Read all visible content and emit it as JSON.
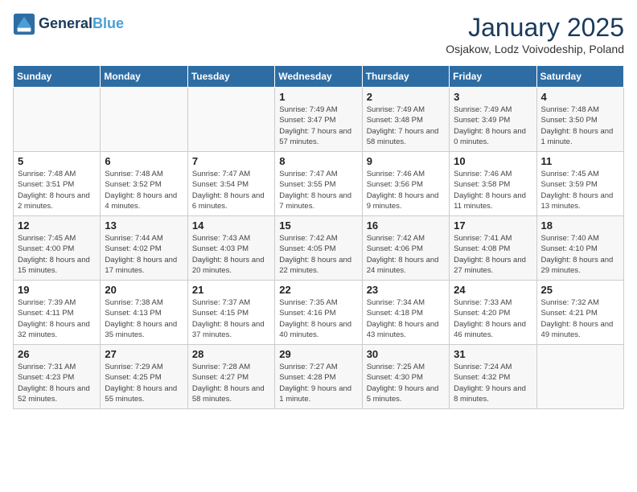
{
  "header": {
    "logo_line1": "General",
    "logo_line2": "Blue",
    "title": "January 2025",
    "subtitle": "Osjakow, Lodz Voivodeship, Poland"
  },
  "days_of_week": [
    "Sunday",
    "Monday",
    "Tuesday",
    "Wednesday",
    "Thursday",
    "Friday",
    "Saturday"
  ],
  "weeks": [
    [
      {
        "day": "",
        "info": ""
      },
      {
        "day": "",
        "info": ""
      },
      {
        "day": "",
        "info": ""
      },
      {
        "day": "1",
        "info": "Sunrise: 7:49 AM\nSunset: 3:47 PM\nDaylight: 7 hours and 57 minutes."
      },
      {
        "day": "2",
        "info": "Sunrise: 7:49 AM\nSunset: 3:48 PM\nDaylight: 7 hours and 58 minutes."
      },
      {
        "day": "3",
        "info": "Sunrise: 7:49 AM\nSunset: 3:49 PM\nDaylight: 8 hours and 0 minutes."
      },
      {
        "day": "4",
        "info": "Sunrise: 7:48 AM\nSunset: 3:50 PM\nDaylight: 8 hours and 1 minute."
      }
    ],
    [
      {
        "day": "5",
        "info": "Sunrise: 7:48 AM\nSunset: 3:51 PM\nDaylight: 8 hours and 2 minutes."
      },
      {
        "day": "6",
        "info": "Sunrise: 7:48 AM\nSunset: 3:52 PM\nDaylight: 8 hours and 4 minutes."
      },
      {
        "day": "7",
        "info": "Sunrise: 7:47 AM\nSunset: 3:54 PM\nDaylight: 8 hours and 6 minutes."
      },
      {
        "day": "8",
        "info": "Sunrise: 7:47 AM\nSunset: 3:55 PM\nDaylight: 8 hours and 7 minutes."
      },
      {
        "day": "9",
        "info": "Sunrise: 7:46 AM\nSunset: 3:56 PM\nDaylight: 8 hours and 9 minutes."
      },
      {
        "day": "10",
        "info": "Sunrise: 7:46 AM\nSunset: 3:58 PM\nDaylight: 8 hours and 11 minutes."
      },
      {
        "day": "11",
        "info": "Sunrise: 7:45 AM\nSunset: 3:59 PM\nDaylight: 8 hours and 13 minutes."
      }
    ],
    [
      {
        "day": "12",
        "info": "Sunrise: 7:45 AM\nSunset: 4:00 PM\nDaylight: 8 hours and 15 minutes."
      },
      {
        "day": "13",
        "info": "Sunrise: 7:44 AM\nSunset: 4:02 PM\nDaylight: 8 hours and 17 minutes."
      },
      {
        "day": "14",
        "info": "Sunrise: 7:43 AM\nSunset: 4:03 PM\nDaylight: 8 hours and 20 minutes."
      },
      {
        "day": "15",
        "info": "Sunrise: 7:42 AM\nSunset: 4:05 PM\nDaylight: 8 hours and 22 minutes."
      },
      {
        "day": "16",
        "info": "Sunrise: 7:42 AM\nSunset: 4:06 PM\nDaylight: 8 hours and 24 minutes."
      },
      {
        "day": "17",
        "info": "Sunrise: 7:41 AM\nSunset: 4:08 PM\nDaylight: 8 hours and 27 minutes."
      },
      {
        "day": "18",
        "info": "Sunrise: 7:40 AM\nSunset: 4:10 PM\nDaylight: 8 hours and 29 minutes."
      }
    ],
    [
      {
        "day": "19",
        "info": "Sunrise: 7:39 AM\nSunset: 4:11 PM\nDaylight: 8 hours and 32 minutes."
      },
      {
        "day": "20",
        "info": "Sunrise: 7:38 AM\nSunset: 4:13 PM\nDaylight: 8 hours and 35 minutes."
      },
      {
        "day": "21",
        "info": "Sunrise: 7:37 AM\nSunset: 4:15 PM\nDaylight: 8 hours and 37 minutes."
      },
      {
        "day": "22",
        "info": "Sunrise: 7:35 AM\nSunset: 4:16 PM\nDaylight: 8 hours and 40 minutes."
      },
      {
        "day": "23",
        "info": "Sunrise: 7:34 AM\nSunset: 4:18 PM\nDaylight: 8 hours and 43 minutes."
      },
      {
        "day": "24",
        "info": "Sunrise: 7:33 AM\nSunset: 4:20 PM\nDaylight: 8 hours and 46 minutes."
      },
      {
        "day": "25",
        "info": "Sunrise: 7:32 AM\nSunset: 4:21 PM\nDaylight: 8 hours and 49 minutes."
      }
    ],
    [
      {
        "day": "26",
        "info": "Sunrise: 7:31 AM\nSunset: 4:23 PM\nDaylight: 8 hours and 52 minutes."
      },
      {
        "day": "27",
        "info": "Sunrise: 7:29 AM\nSunset: 4:25 PM\nDaylight: 8 hours and 55 minutes."
      },
      {
        "day": "28",
        "info": "Sunrise: 7:28 AM\nSunset: 4:27 PM\nDaylight: 8 hours and 58 minutes."
      },
      {
        "day": "29",
        "info": "Sunrise: 7:27 AM\nSunset: 4:28 PM\nDaylight: 9 hours and 1 minute."
      },
      {
        "day": "30",
        "info": "Sunrise: 7:25 AM\nSunset: 4:30 PM\nDaylight: 9 hours and 5 minutes."
      },
      {
        "day": "31",
        "info": "Sunrise: 7:24 AM\nSunset: 4:32 PM\nDaylight: 9 hours and 8 minutes."
      },
      {
        "day": "",
        "info": ""
      }
    ]
  ]
}
